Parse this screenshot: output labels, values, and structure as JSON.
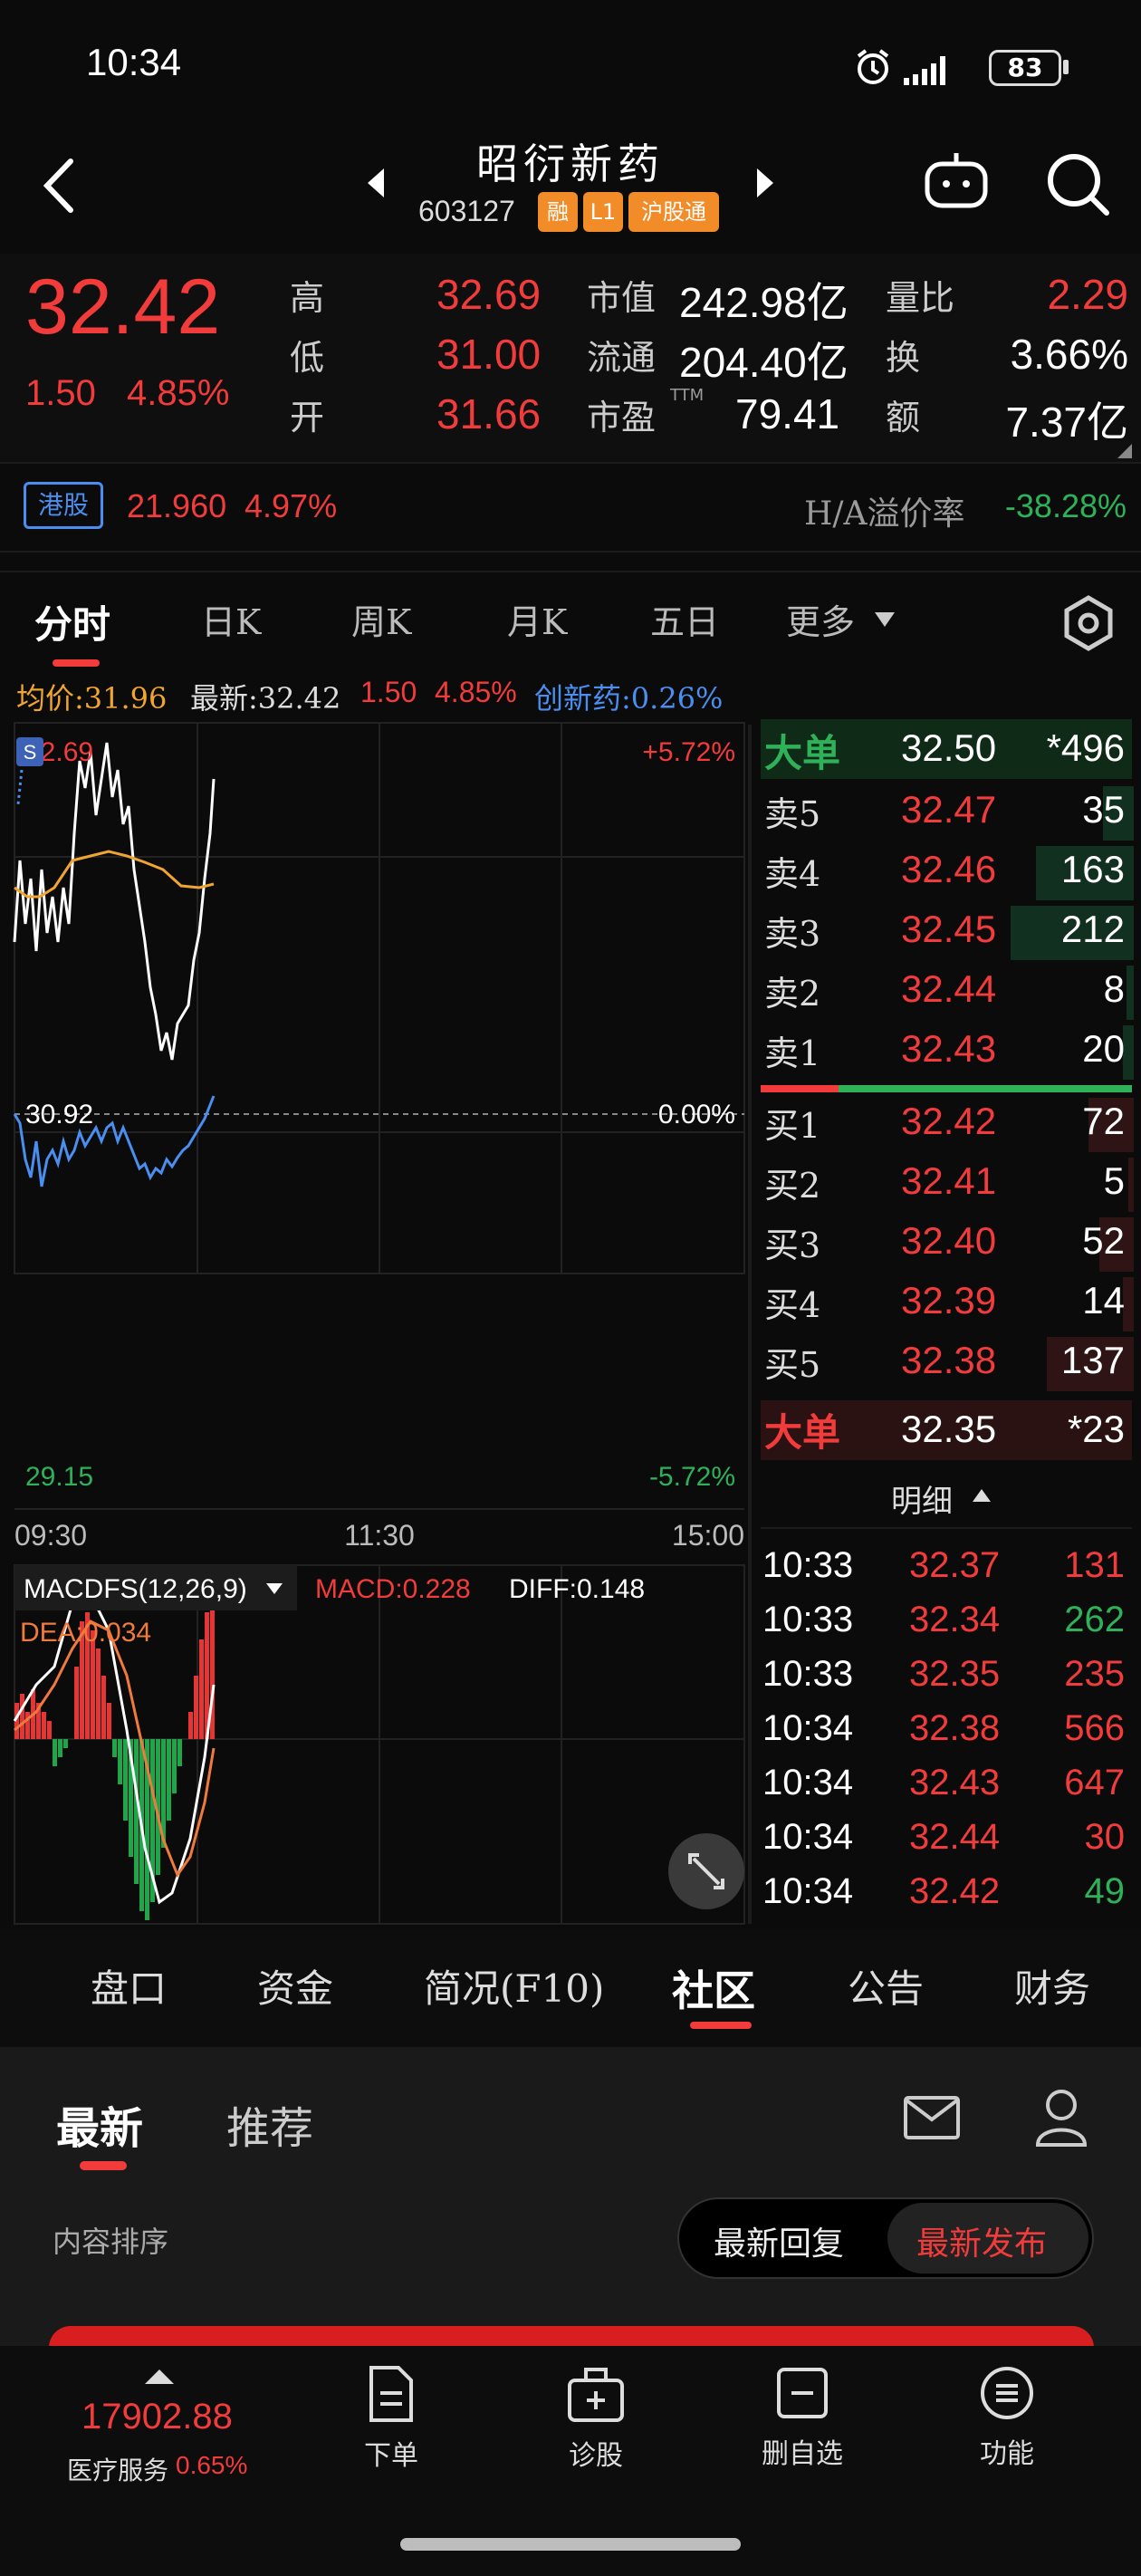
{
  "status_bar": {
    "time": "10:34",
    "battery": "83"
  },
  "title": {
    "stock_name": "昭衍新药",
    "stock_code": "603127",
    "badges": [
      "融",
      "L1",
      "沪股通"
    ]
  },
  "quote": {
    "price": "32.42",
    "change": "1.50",
    "change_pct": "4.85%",
    "high_label": "高",
    "high": "32.69",
    "low_label": "低",
    "low": "31.00",
    "open_label": "开",
    "open": "31.66",
    "mcap_label": "市值",
    "mcap": "242.98亿",
    "float_label": "流通",
    "float": "204.40亿",
    "pe_label": "市盈",
    "pe_sup": "TTM",
    "pe": "79.41",
    "volratio_label": "量比",
    "volratio": "2.29",
    "turnover_label": "换",
    "turnover": "3.66%",
    "amount_label": "额",
    "amount": "7.37亿"
  },
  "hk": {
    "tag": "港股",
    "price": "21.960",
    "pct": "4.97%",
    "premium_label": "H/A溢价率",
    "premium": "-38.28%"
  },
  "chart_tabs": [
    "分时",
    "日K",
    "周K",
    "月K",
    "五日",
    "更多"
  ],
  "chart_header": {
    "avg": "均价:31.96",
    "latest": "最新:32.42",
    "chg": "1.50",
    "chg_pct": "4.85%",
    "index": "创新药:0.26%"
  },
  "chart_labels": {
    "top_price": "32.69",
    "top_pct": "+5.72%",
    "mid_price": "30.92",
    "mid_pct": "0.00%",
    "bot_price": "29.15",
    "bot_pct": "-5.72%",
    "t_start": "09:30",
    "t_mid": "11:30",
    "t_end": "15:00",
    "macd_name": "MACDFS(12,26,9)",
    "macd": "MACD:0.228",
    "diff": "DIFF:0.148",
    "dea": "DEA:0.034",
    "s_badge": "S"
  },
  "orderbook": {
    "big_sell": {
      "label": "大单",
      "price": "32.50",
      "vol": "*496"
    },
    "asks": [
      {
        "label": "卖5",
        "price": "32.47",
        "vol": "35"
      },
      {
        "label": "卖4",
        "price": "32.46",
        "vol": "163"
      },
      {
        "label": "卖3",
        "price": "32.45",
        "vol": "212"
      },
      {
        "label": "卖2",
        "price": "32.44",
        "vol": "8"
      },
      {
        "label": "卖1",
        "price": "32.43",
        "vol": "20"
      }
    ],
    "bids": [
      {
        "label": "买1",
        "price": "32.42",
        "vol": "72"
      },
      {
        "label": "买2",
        "price": "32.41",
        "vol": "5"
      },
      {
        "label": "买3",
        "price": "32.40",
        "vol": "52"
      },
      {
        "label": "买4",
        "price": "32.39",
        "vol": "14"
      },
      {
        "label": "买5",
        "price": "32.38",
        "vol": "137"
      }
    ],
    "big_buy": {
      "label": "大单",
      "price": "32.35",
      "vol": "*23"
    },
    "detail_label": "明细"
  },
  "ticks": [
    {
      "time": "10:33",
      "price": "32.37",
      "vol": "131",
      "side": "red"
    },
    {
      "time": "10:33",
      "price": "32.34",
      "vol": "262",
      "side": "green"
    },
    {
      "time": "10:33",
      "price": "32.35",
      "vol": "235",
      "side": "red"
    },
    {
      "time": "10:34",
      "price": "32.38",
      "vol": "566",
      "side": "red"
    },
    {
      "time": "10:34",
      "price": "32.43",
      "vol": "647",
      "side": "red"
    },
    {
      "time": "10:34",
      "price": "32.44",
      "vol": "30",
      "side": "red"
    },
    {
      "time": "10:34",
      "price": "32.42",
      "vol": "49",
      "side": "green"
    }
  ],
  "section_tabs": [
    "盘口",
    "资金",
    "简况(F10)",
    "社区",
    "公告",
    "财务"
  ],
  "community": {
    "tab_latest": "最新",
    "tab_recommend": "推荐",
    "sort_label": "内容排序",
    "sort_reply": "最新回复",
    "sort_publish": "最新发布"
  },
  "bottom_nav": {
    "index_value": "17902.88",
    "index_name": "医疗服务",
    "index_pct": "0.65%",
    "items": [
      "下单",
      "诊股",
      "删自选",
      "功能"
    ]
  }
}
